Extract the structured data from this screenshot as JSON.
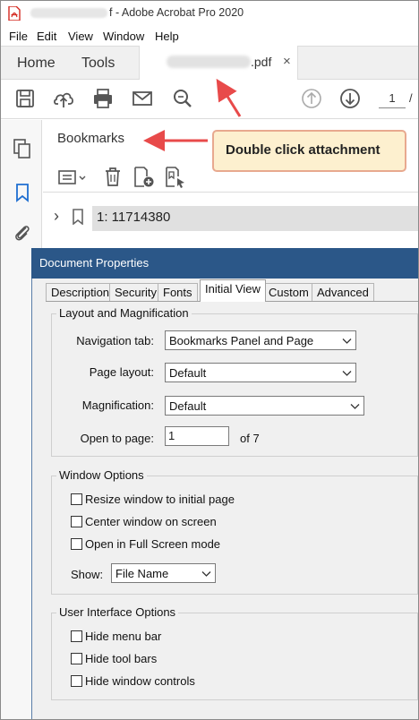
{
  "window": {
    "title_suffix": "f - Adobe Acrobat Pro 2020"
  },
  "menu": [
    "File",
    "Edit",
    "View",
    "Window",
    "Help"
  ],
  "nav_tabs": {
    "home": "Home",
    "tools": "Tools"
  },
  "document_tab": {
    "label": ".pdf",
    "close": "×"
  },
  "toolbar": {
    "icons": [
      "save-icon",
      "upload-cloud-icon",
      "print-icon",
      "email-icon",
      "zoom-search-icon",
      "page-up-icon",
      "page-down-icon"
    ],
    "page_number": "1",
    "page_separator": "/"
  },
  "left_rail": {
    "icons": [
      "pages-icon",
      "bookmark-icon",
      "attachment-icon"
    ]
  },
  "bookmarks": {
    "title": "Bookmarks",
    "tools": [
      "options-menu-icon",
      "delete-icon",
      "new-bookmark-icon",
      "bookmark-from-structure-icon"
    ],
    "items": [
      {
        "label": "1: 11714380",
        "expand": "›"
      }
    ]
  },
  "callout": {
    "text": "Double click attachment"
  },
  "dialog": {
    "title": "Document Properties",
    "tabs": [
      "Description",
      "Security",
      "Fonts",
      "Initial View",
      "Custom",
      "Advanced"
    ],
    "active_tab": "Initial View",
    "layout_group": {
      "title": "Layout and Magnification",
      "navigation_tab_label": "Navigation tab:",
      "navigation_tab_value": "Bookmarks Panel and Page",
      "page_layout_label": "Page layout:",
      "page_layout_value": "Default",
      "magnification_label": "Magnification:",
      "magnification_value": "Default",
      "open_to_page_label": "Open to page:",
      "open_to_page_value": "1",
      "page_count_text": "of 7"
    },
    "window_group": {
      "title": "Window Options",
      "options": [
        {
          "label": "Resize window to initial page",
          "checked": false
        },
        {
          "label": "Center window on screen",
          "checked": false
        },
        {
          "label": "Open in Full Screen mode",
          "checked": false
        }
      ],
      "show_label": "Show:",
      "show_value": "File Name"
    },
    "ui_group": {
      "title": "User Interface Options",
      "options": [
        {
          "label": "Hide menu bar",
          "checked": false
        },
        {
          "label": "Hide tool bars",
          "checked": false
        },
        {
          "label": "Hide window controls",
          "checked": false
        }
      ]
    }
  },
  "colors": {
    "dialog_titlebar": "#2b5788",
    "callout_bg": "#fdf0cf",
    "callout_border": "#e8a98f",
    "arrow": "#e84a4a",
    "acrobat_red": "#d4281f"
  }
}
